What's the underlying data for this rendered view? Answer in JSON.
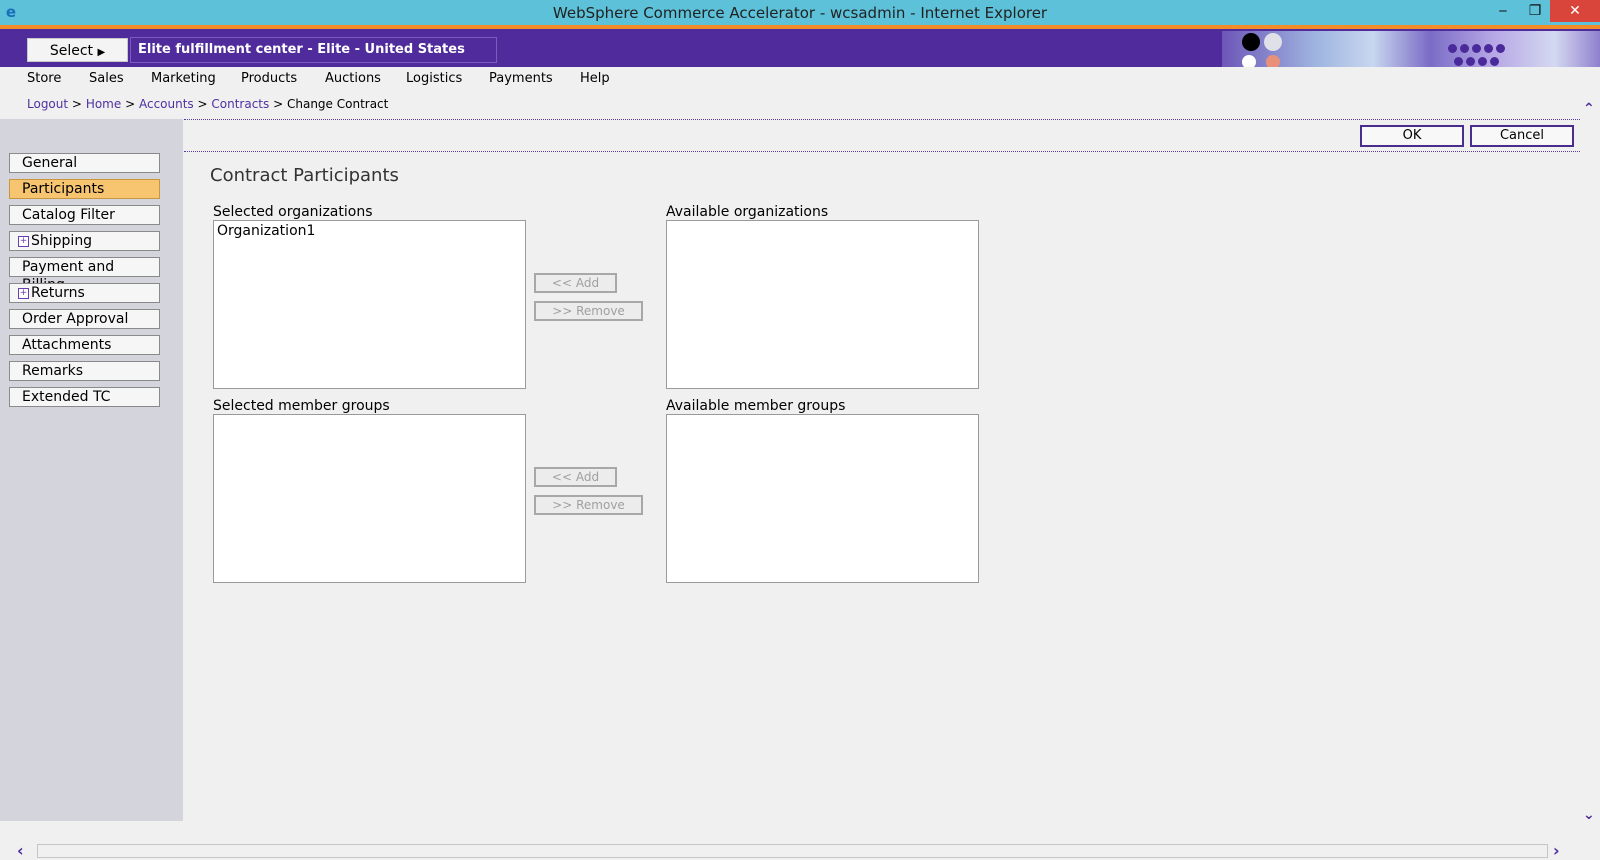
{
  "window": {
    "title": "WebSphere Commerce Accelerator - wcsadmin - Internet Explorer",
    "icon": "ie-icon",
    "controls": {
      "minimize": "‒",
      "restore": "❐",
      "close": "✕"
    }
  },
  "banner": {
    "select_label": "Select",
    "store": "Elite fulfillment center - Elite - United States English"
  },
  "menu": [
    "Store",
    "Sales",
    "Marketing",
    "Products",
    "Auctions",
    "Logistics",
    "Payments",
    "Help"
  ],
  "breadcrumb": {
    "links": [
      "Logout",
      "Home",
      "Accounts",
      "Contracts"
    ],
    "separator": ">",
    "current": "Change Contract"
  },
  "nav": {
    "items": [
      {
        "label": "General",
        "expandable": false,
        "active": false
      },
      {
        "label": "Participants",
        "expandable": false,
        "active": true
      },
      {
        "label": "Catalog Filter",
        "expandable": false,
        "active": false
      },
      {
        "label": "Shipping",
        "expandable": true,
        "active": false
      },
      {
        "label": "Payment and Billing",
        "expandable": false,
        "active": false
      },
      {
        "label": "Returns",
        "expandable": true,
        "active": false
      },
      {
        "label": "Order Approval",
        "expandable": false,
        "active": false
      },
      {
        "label": "Attachments",
        "expandable": false,
        "active": false
      },
      {
        "label": "Remarks",
        "expandable": false,
        "active": false
      },
      {
        "label": "Extended TC",
        "expandable": false,
        "active": false
      }
    ]
  },
  "actions": {
    "ok": "OK",
    "cancel": "Cancel"
  },
  "page": {
    "title": "Contract Participants",
    "organizations": {
      "selected_label": "Selected organizations",
      "selected_items": [
        "Organization1"
      ],
      "available_label": "Available organizations",
      "available_items": [],
      "add_label": "<< Add",
      "remove_label": ">> Remove"
    },
    "member_groups": {
      "selected_label": "Selected member groups",
      "selected_items": [],
      "available_label": "Available member groups",
      "available_items": [],
      "add_label": "<< Add",
      "remove_label": ">> Remove"
    }
  },
  "colors": {
    "titlebar": "#5cc1d9",
    "banner": "#4f2b9b",
    "accent_orange": "#f28c28",
    "active_nav": "#f7c470",
    "link": "#5030a0"
  }
}
